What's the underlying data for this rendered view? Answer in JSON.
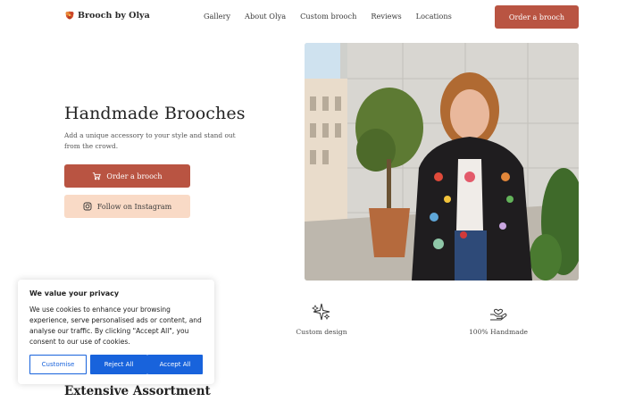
{
  "brand": {
    "name": "Brooch by Olya",
    "icon": "brooch-logo-icon",
    "accent_color": "#b95442"
  },
  "nav": {
    "items": [
      {
        "label": "Gallery"
      },
      {
        "label": "About Olya"
      },
      {
        "label": "Custom brooch"
      },
      {
        "label": "Reviews"
      },
      {
        "label": "Locations"
      }
    ],
    "cta_label": "Order a brooch"
  },
  "hero": {
    "title": "Handmade Brooches",
    "subtitle": "Add a unique accessory to your style and stand out from the crowd.",
    "primary_button": {
      "label": "Order a brooch",
      "icon": "cart-icon"
    },
    "secondary_button": {
      "label": "Follow on Instagram",
      "icon": "instagram-icon"
    },
    "secondary_color": "#f9dac6"
  },
  "features": [
    {
      "label": "Custom design",
      "icon": "sparkle-icon"
    },
    {
      "label": "100% Handmade",
      "icon": "hand-heart-icon"
    }
  ],
  "section_heading": "Extensive Assortment",
  "cookie": {
    "title": "We value your privacy",
    "text": "We use cookies to enhance your browsing experience, serve personalised ads or content, and analyse our traffic. By clicking \"Accept All\", you consent to our use of cookies.",
    "customise_label": "Customise",
    "reject_label": "Reject All",
    "accept_label": "Accept All",
    "button_color": "#1863dc"
  }
}
